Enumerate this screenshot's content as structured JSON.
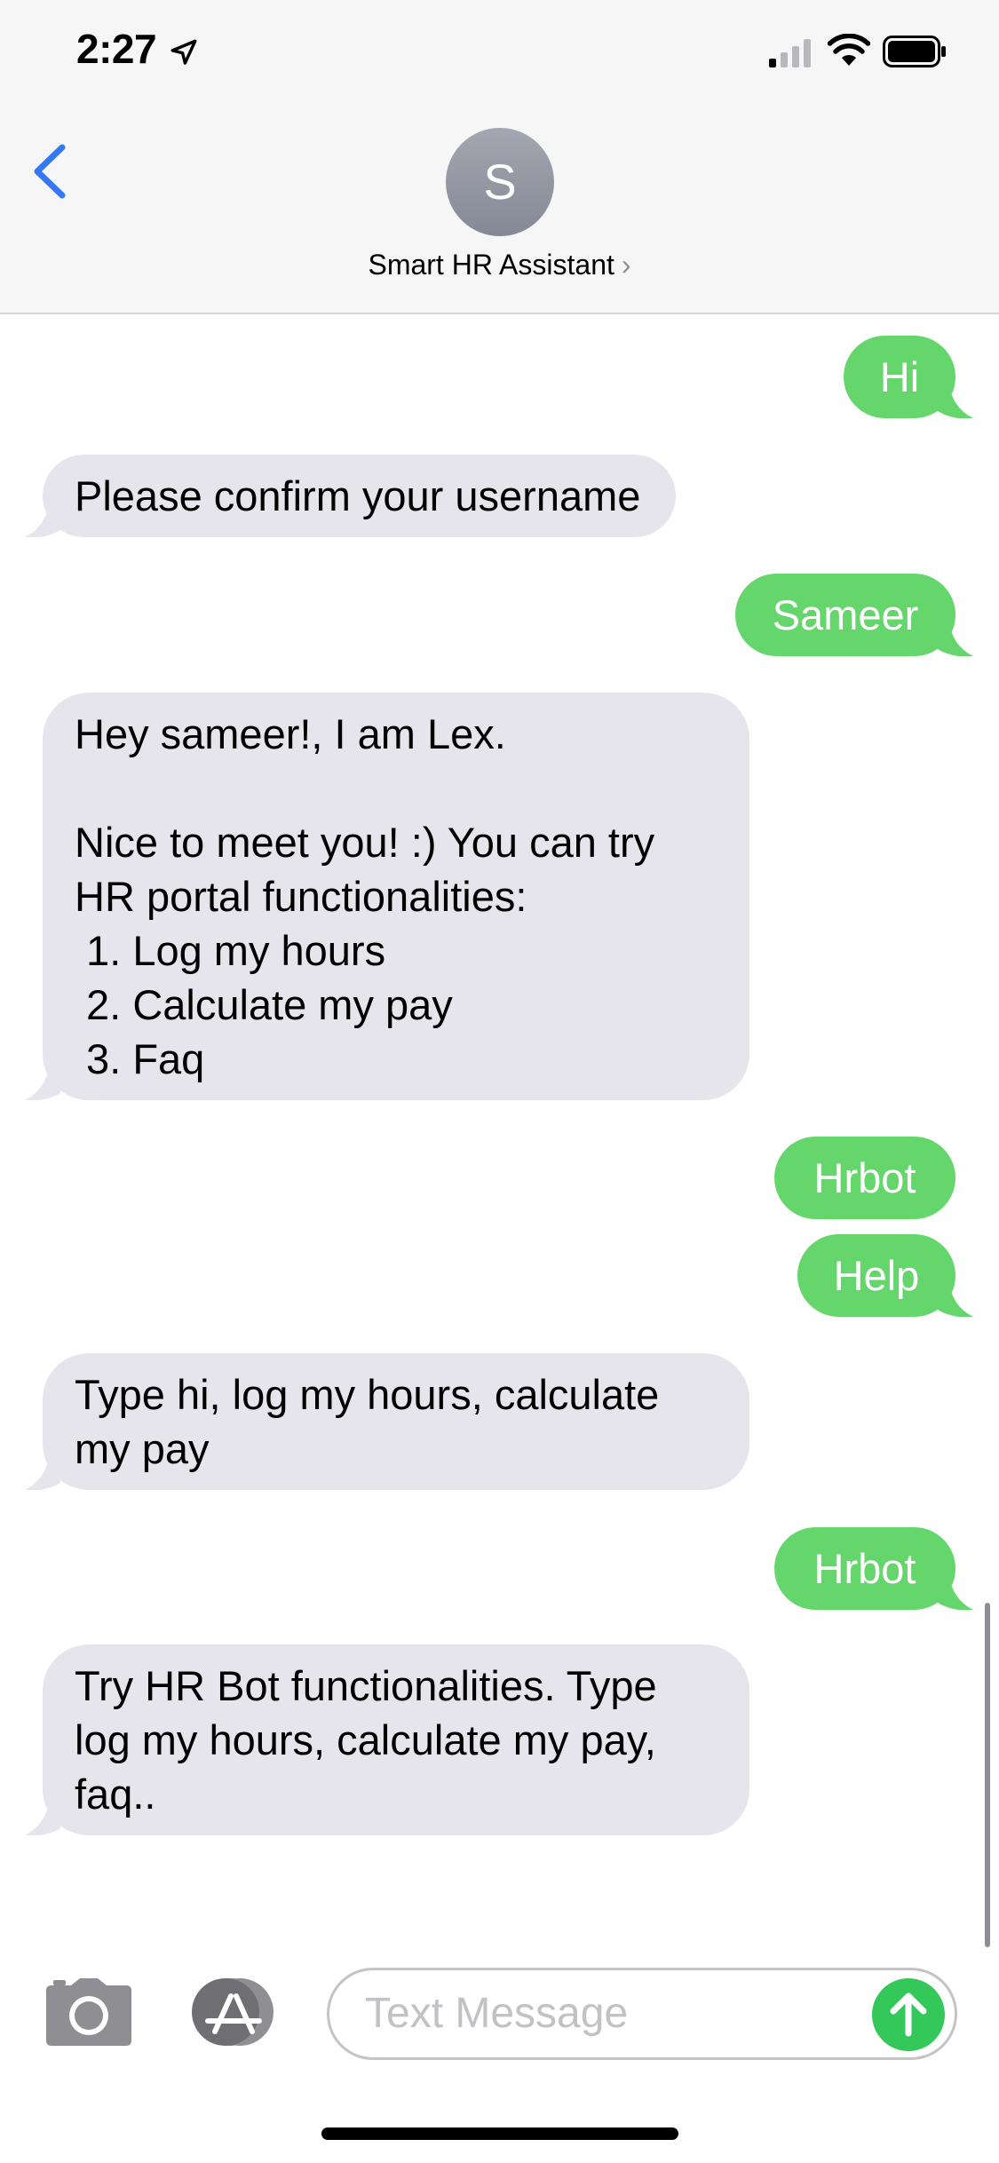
{
  "status_bar": {
    "time": "2:27"
  },
  "header": {
    "avatar_initial": "S",
    "contact_name": "Smart HR Assistant",
    "chevron": "›"
  },
  "messages": [
    {
      "from": "me",
      "text": "Hi"
    },
    {
      "from": "bot",
      "text": "Please confirm your username"
    },
    {
      "from": "me",
      "text": "Sameer"
    },
    {
      "from": "bot",
      "text": "Hey sameer!, I am Lex.\n\nNice to meet you! :) You can try\nHR portal functionalities:\n 1. Log my hours\n 2. Calculate my pay\n 3. Faq"
    },
    {
      "from": "me",
      "text": "Hrbot"
    },
    {
      "from": "me",
      "text": "Help"
    },
    {
      "from": "bot",
      "text": "Type hi, log my hours, calculate\nmy pay"
    },
    {
      "from": "me",
      "text": "Hrbot"
    },
    {
      "from": "bot",
      "text": "Try HR Bot functionalities. Type\nlog my hours, calculate my pay,\nfaq.."
    }
  ],
  "composer": {
    "placeholder": "Text Message"
  },
  "icons": [
    "location-arrow-icon",
    "cellular-signal-icon",
    "wifi-icon",
    "battery-icon",
    "back-chevron-icon",
    "camera-icon",
    "app-store-icon",
    "send-arrow-icon"
  ],
  "colors": {
    "sent_bubble": "#65d66c",
    "received_bubble": "#e6e5eb",
    "accent_blue": "#3478f6",
    "header_bg": "#f6f6f6"
  }
}
